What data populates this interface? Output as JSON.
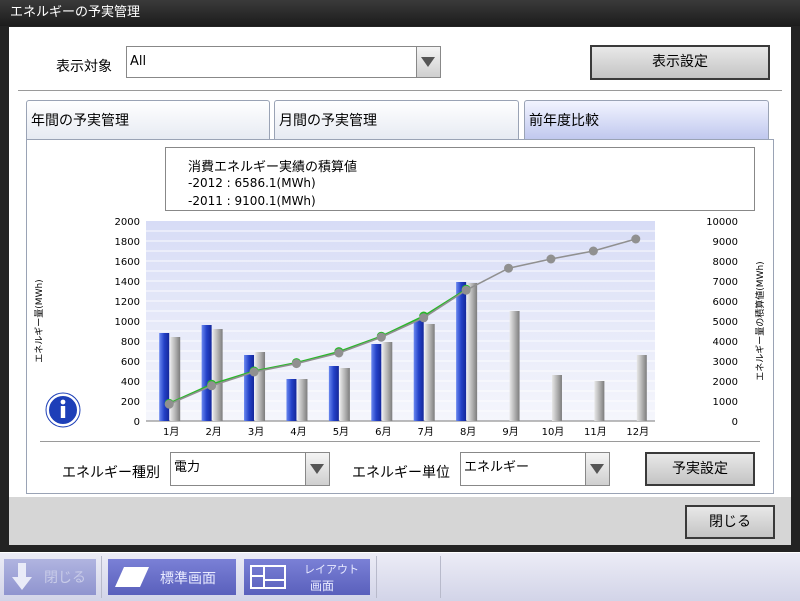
{
  "window": {
    "title": "エネルギーの予実管理"
  },
  "top": {
    "display_target_label": "表示対象",
    "display_target_value": "All",
    "display_settings_button": "表示設定"
  },
  "tabs": [
    {
      "label": "年間の予実管理",
      "active": false
    },
    {
      "label": "月間の予実管理",
      "active": false
    },
    {
      "label": "前年度比較",
      "active": true
    }
  ],
  "info_box": {
    "title": "消費エネルギー実績の積算値",
    "line1": "-2012 : 6586.1(MWh)",
    "line2": "-2011 : 9100.1(MWh)"
  },
  "chart_data": {
    "type": "bar",
    "categories": [
      "1月",
      "2月",
      "3月",
      "4月",
      "5月",
      "6月",
      "7月",
      "8月",
      "9月",
      "10月",
      "11月",
      "12月"
    ],
    "ylabel": "エネルギー量(MWh)",
    "ylabel_right": "エネルギー量の積算値(MWh)",
    "ylim": [
      0,
      2000
    ],
    "yticks": [
      "0",
      "200",
      "400",
      "600",
      "800",
      "1000",
      "1200",
      "1400",
      "1600",
      "1800",
      "2000"
    ],
    "ylim_right": [
      0,
      10000
    ],
    "yticks_right": [
      "0",
      "1000",
      "2000",
      "3000",
      "4000",
      "5000",
      "6000",
      "7000",
      "8000",
      "9000",
      "10000"
    ],
    "grid": true,
    "series": [
      {
        "type": "bar",
        "axis": "left",
        "color": "#2a4fd0",
        "values": [
          880,
          960,
          660,
          420,
          550,
          770,
          1010,
          1390,
          null,
          null,
          null,
          null
        ]
      },
      {
        "type": "bar",
        "axis": "left",
        "color": "#a8a8a8",
        "values": [
          840,
          920,
          690,
          420,
          530,
          790,
          970,
          1380,
          1100,
          460,
          400,
          660
        ]
      },
      {
        "type": "line",
        "axis": "right",
        "color": "#28b828",
        "values": [
          880,
          1840,
          2500,
          2920,
          3470,
          4240,
          5250,
          6586.1,
          null,
          null,
          null,
          null
        ]
      },
      {
        "type": "line",
        "axis": "right",
        "color": "#909090",
        "values": [
          840,
          1760,
          2450,
          2870,
          3400,
          4190,
          5160,
          6540,
          7640,
          8100,
          8500,
          9100.1
        ]
      }
    ]
  },
  "bottom": {
    "energy_type_label": "エネルギー種別",
    "energy_type_value": "電力",
    "energy_unit_label": "エネルギー単位",
    "energy_unit_value": "エネルギー",
    "budget_settings_button": "予実設定",
    "close_button": "閉じる"
  },
  "taskbar": {
    "close_label": "閉じる",
    "standard_screen_label": "標準画面",
    "layout_screen_line1": "レイアウト",
    "layout_screen_line2": "画面"
  },
  "colors": {
    "accent": "#2a4fd0",
    "taskbar_button": "#6a70c8"
  },
  "icons": {
    "info": "info-icon",
    "dropdown": "chevron-down-icon"
  }
}
